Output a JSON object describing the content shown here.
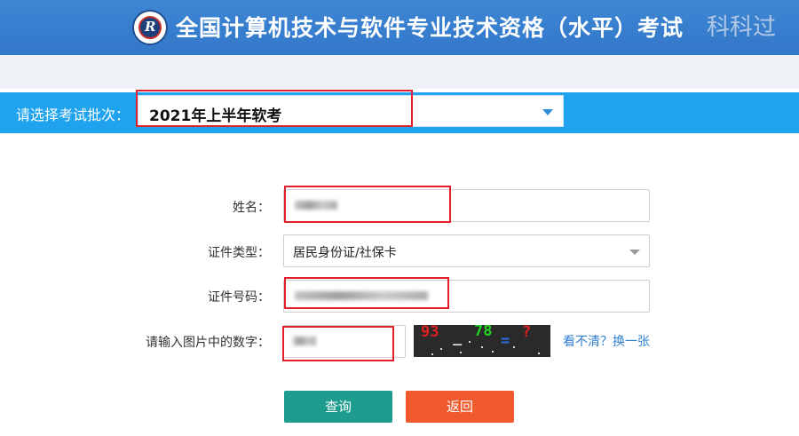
{
  "header": {
    "title": "全国计算机技术与软件专业技术资格（水平）考试",
    "logo_mark": "R",
    "watermark": "科科过"
  },
  "exam_selector": {
    "label": "请选择考试批次：",
    "selected": "2021年上半年软考"
  },
  "form": {
    "name": {
      "label": "姓名："
    },
    "id_type": {
      "label": "证件类型：",
      "selected": "居民身份证/社保卡"
    },
    "id_number": {
      "label": "证件号码："
    },
    "captcha": {
      "label": "请输入图片中的数字：",
      "refresh_link": "看不清？换一张"
    }
  },
  "captcha_image": {
    "glyphs": [
      {
        "text": "93",
        "color": "#e02020"
      },
      {
        "text": "_",
        "color": "#e8e8e8"
      },
      {
        "text": "78",
        "color": "#22d222"
      },
      {
        "text": "=",
        "color": "#2f6de0"
      },
      {
        "text": "?",
        "color": "#e02020"
      }
    ]
  },
  "buttons": {
    "query": "查询",
    "back": "返回"
  },
  "colors": {
    "header_blue": "#3377c9",
    "selector_blue": "#20a3ee",
    "query_teal": "#1e9d8e",
    "back_orange": "#f15a2c",
    "highlight_red": "#e0202a"
  }
}
